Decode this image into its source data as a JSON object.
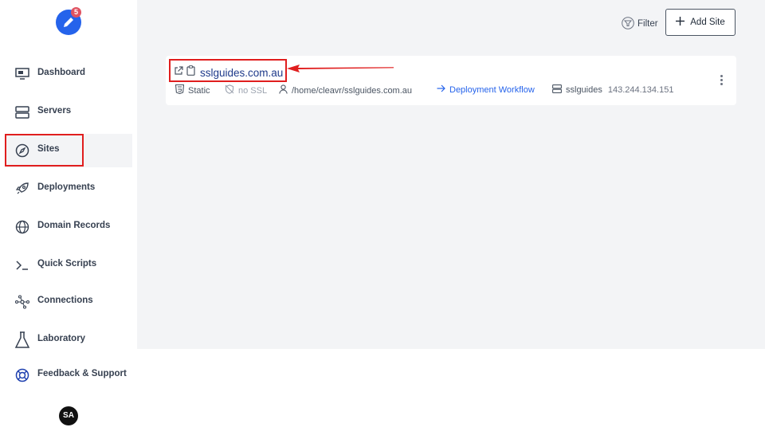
{
  "app": {
    "notification_count": "5",
    "user_initials": "SA"
  },
  "sidebar": {
    "items": [
      {
        "label": "Dashboard",
        "icon": "monitor-icon"
      },
      {
        "label": "Servers",
        "icon": "server-icon"
      },
      {
        "label": "Sites",
        "icon": "compass-icon",
        "active": true
      },
      {
        "label": "Deployments",
        "icon": "rocket-icon"
      },
      {
        "label": "Domain Records",
        "icon": "globe-icon"
      },
      {
        "label": "Quick Scripts",
        "icon": "terminal-icon"
      },
      {
        "label": "Connections",
        "icon": "network-icon"
      },
      {
        "label": "Laboratory",
        "icon": "flask-icon"
      },
      {
        "label": "Feedback & Support",
        "icon": "lifebuoy-icon"
      }
    ]
  },
  "toolbar": {
    "filter_label": "Filter",
    "add_site_label": "Add Site"
  },
  "site": {
    "name": "sslguides.com.au",
    "type": "Static",
    "ssl_status": "no SSL",
    "path": "/home/cleavr/sslguides.com.au",
    "workflow_label": "Deployment Workflow",
    "server_name": "sslguides",
    "server_ip": "143.244.134.151"
  },
  "colors": {
    "accent": "#2563eb",
    "highlight": "#e01e1e",
    "background": "#f3f4f6"
  }
}
